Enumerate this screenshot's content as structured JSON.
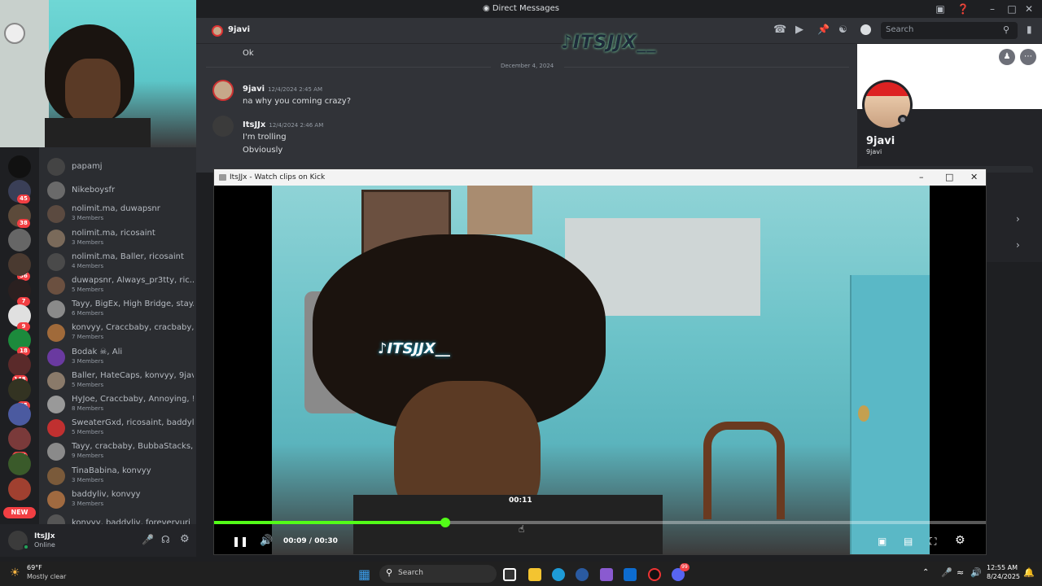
{
  "window": {
    "title": "Direct Messages"
  },
  "dm_list": [
    {
      "name": "papamj",
      "members": ""
    },
    {
      "name": "Nikeboysfr",
      "members": ""
    },
    {
      "name": "nolimit.ma, duwapsnr",
      "members": "3 Members"
    },
    {
      "name": "nolimit.ma, ricosaint",
      "members": "3 Members"
    },
    {
      "name": "nolimit.ma, Baller, ricosaint",
      "members": "4 Members"
    },
    {
      "name": "duwapsnr, Always_pr3tty, ric...",
      "members": "5 Members"
    },
    {
      "name": "Tayy, BigEx, High Bridge, stay...",
      "members": "6 Members"
    },
    {
      "name": "konvyy, Craccbaby, cracbaby, ...",
      "members": "7 Members"
    },
    {
      "name": "Bodak ☠, Ali",
      "members": "3 Members"
    },
    {
      "name": "Baller, HateCaps, konvyy, 9javi",
      "members": "5 Members"
    },
    {
      "name": "HyJoe, Craccbaby, Annoying, !...",
      "members": "8 Members"
    },
    {
      "name": "SweaterGxd, ricosaint, baddyl...",
      "members": "5 Members"
    },
    {
      "name": "Tayy, cracbaby, BubbaStacks, ...",
      "members": "9 Members"
    },
    {
      "name": "TinaBabina, konvyy",
      "members": "3 Members"
    },
    {
      "name": "baddyliv, konvyy",
      "members": "3 Members"
    },
    {
      "name": "konvyy, baddyliv, foreveryuri",
      "members": ""
    }
  ],
  "server_badges": [
    "45",
    "38",
    "36",
    "7",
    "9",
    "18",
    "148",
    "55",
    "301",
    "197"
  ],
  "new_badge": "NEW",
  "user": {
    "name": "ItsJJx",
    "status": "Online"
  },
  "chat": {
    "header_name": "9javi",
    "search_placeholder": "Search",
    "top_message": "Ok",
    "date_divider": "December 4, 2024",
    "messages": [
      {
        "author": "9javi",
        "time": "12/4/2024 2:45 AM",
        "lines": [
          "na why you coming crazy?"
        ]
      },
      {
        "author": "ItsJJx",
        "time": "12/4/2024 2:46 AM",
        "lines": [
          "I'm trolling",
          "Obviously"
        ]
      }
    ],
    "watermark": "ITSJJX__"
  },
  "profile": {
    "display_name": "9javi",
    "username": "9javi"
  },
  "video_window": {
    "title": "ItsJJx - Watch clips on Kick",
    "current_time": "00:09",
    "separator": "/",
    "duration": "00:30",
    "hover_time": "00:11",
    "progress_fraction": 0.3,
    "watermark": "ITSJJX__",
    "accent_color": "#53fc18"
  },
  "taskbar": {
    "weather_temp": "69°F",
    "weather_desc": "Mostly clear",
    "search_placeholder": "Search",
    "time": "12:55 AM",
    "date": "8/24/2025",
    "notif_badge": "99"
  }
}
